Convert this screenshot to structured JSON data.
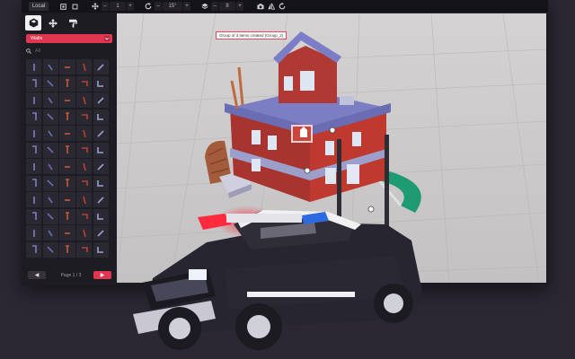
{
  "toolbar": {
    "space_label": "Local",
    "move_step": "1",
    "rotate_step": "15°",
    "layer_step": "8"
  },
  "sidebar": {
    "category": "Walls",
    "search_placeholder": "All",
    "pager": {
      "prev": "◀",
      "label": "Page 1 / 3",
      "next": "▶"
    }
  },
  "viewport": {
    "status": "Group of 3 items created (Group_2)"
  },
  "colors": {
    "accent": "#e0364f",
    "background": "#2b2733",
    "panel": "#1e1c23",
    "toolbar": "#141317"
  }
}
